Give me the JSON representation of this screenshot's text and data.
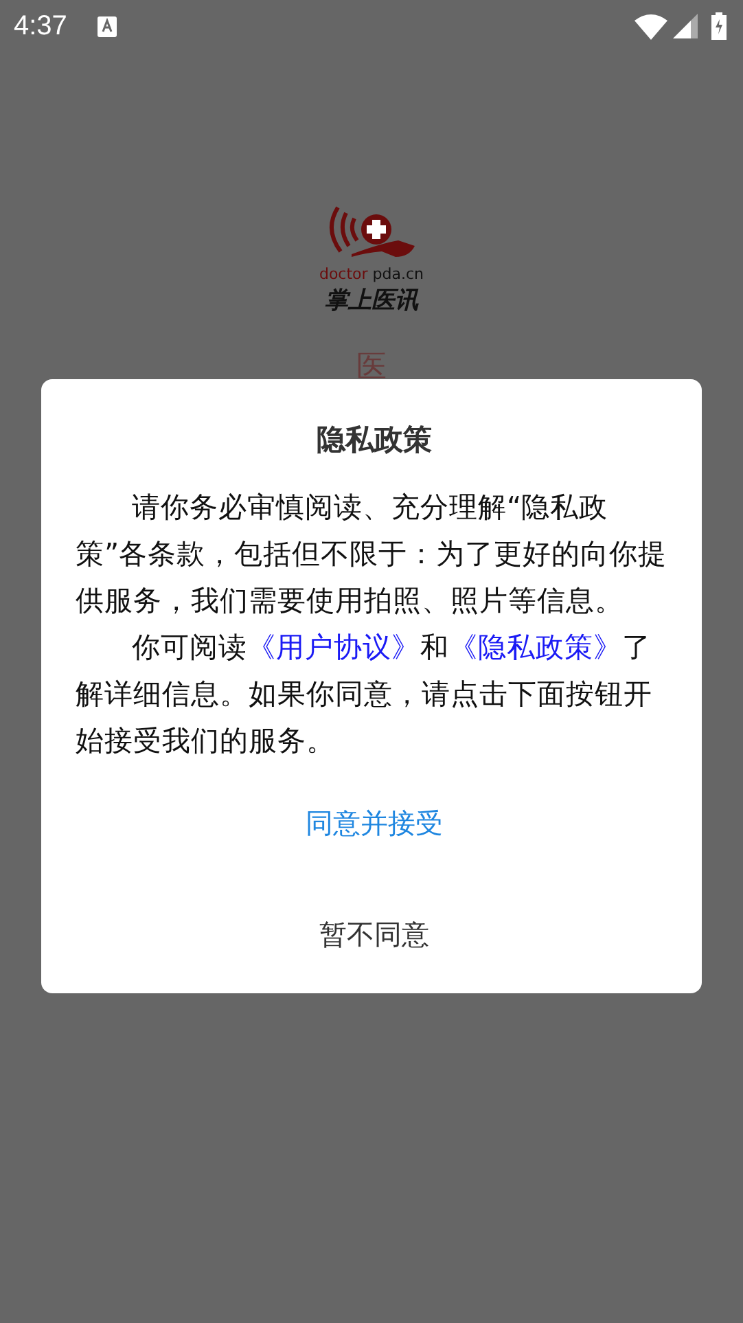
{
  "status_bar": {
    "time": "4:37"
  },
  "app": {
    "domain_prefix": "doctor",
    "domain": "pda.cn",
    "name": "掌上医讯",
    "splash_text": "医"
  },
  "dialog": {
    "title": "隐私政策",
    "paragraph_1": "请你务必审慎阅读、充分理解“隐私政策”各条款，包括但不限于：为了更好的向你提供服务，我们需要使用拍照、照片等信息。",
    "paragraph_2": {
      "before": "你可阅读",
      "link_1": "《用户协议》",
      "middle": "和",
      "link_2": "《隐私政策》",
      "after": "了解详细信息。如果你同意，请点击下面按钮开始接受我们的服务。"
    },
    "buttons": [
      {
        "label": "同意并接受",
        "kind": "primary"
      },
      {
        "label": "暂不同意",
        "kind": "secondary"
      }
    ]
  }
}
